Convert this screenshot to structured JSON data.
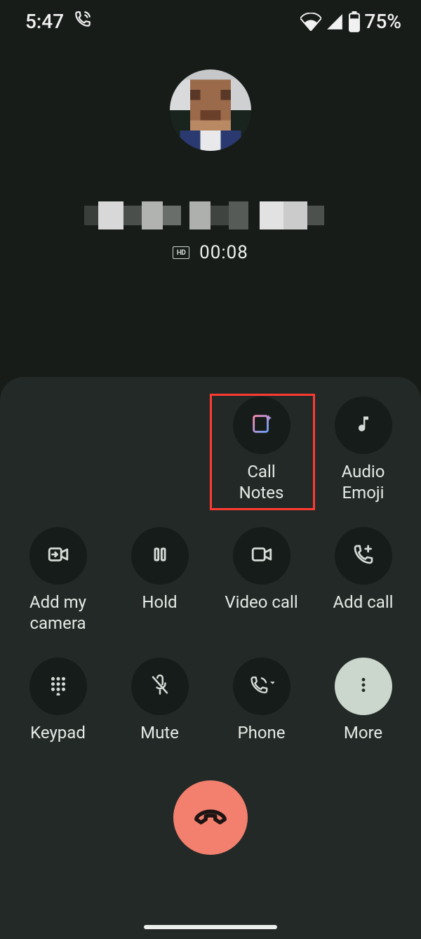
{
  "status": {
    "time": "5:47",
    "battery_pct": "75%"
  },
  "call": {
    "hd_label": "HD",
    "duration": "00:08"
  },
  "actions": {
    "call_notes": "Call\nNotes",
    "audio_emoji": "Audio\nEmoji",
    "add_my_camera": "Add my\ncamera",
    "hold": "Hold",
    "video_call": "Video call",
    "add_call": "Add call",
    "keypad": "Keypad",
    "mute": "Mute",
    "phone": "Phone",
    "more": "More"
  }
}
